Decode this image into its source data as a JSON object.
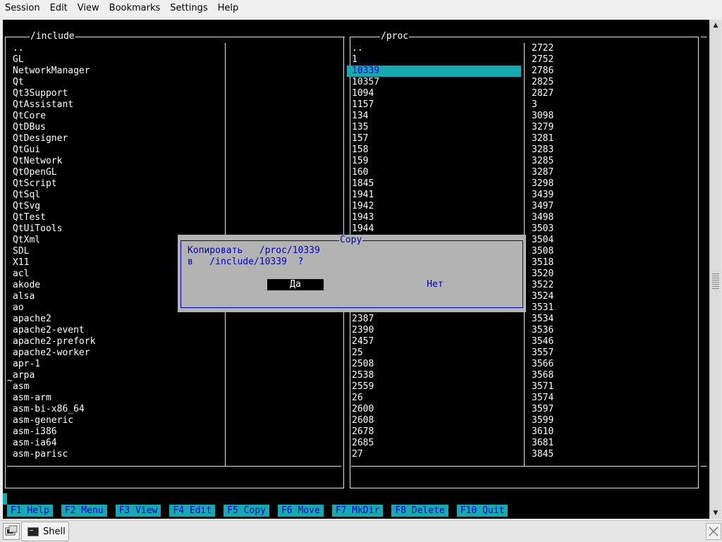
{
  "menubar": {
    "items": [
      "Session",
      "Edit",
      "View",
      "Bookmarks",
      "Settings",
      "Help"
    ]
  },
  "left_panel": {
    "title": "/include",
    "items": [
      "..",
      "GL",
      "NetworkManager",
      "Qt",
      "Qt3Support",
      "QtAssistant",
      "QtCore",
      "QtDBus",
      "QtDesigner",
      "QtGui",
      "QtNetwork",
      "QtOpenGL",
      "QtScript",
      "QtSql",
      "QtSvg",
      "QtTest",
      "QtUiTools",
      "QtXml",
      "SDL",
      "X11",
      "acl",
      "akode",
      "alsa",
      "ao",
      "apache2",
      "apache2-event",
      "apache2-prefork",
      "apache2-worker",
      "apr-1",
      "arpa",
      "asm",
      "asm-arm",
      "asm-bi-x86_64",
      "asm-generic",
      "asm-i386",
      "asm-ia64",
      "asm-parisc"
    ],
    "cursor_mark": "~"
  },
  "right_panel": {
    "title": "/proc",
    "selected": "10339",
    "col1_top": [
      "..",
      "1",
      "10339",
      "10357",
      "1094",
      "1157",
      "134",
      "135",
      "157",
      "158",
      "159",
      "160",
      "1845",
      "1941",
      "1942",
      "1943",
      "1944"
    ],
    "col1_bottom": [
      "2387",
      "2390",
      "2457",
      "25",
      "2508",
      "2538",
      "2559",
      "26",
      "2600",
      "2608",
      "2678",
      "2685",
      "27"
    ],
    "col2": [
      "2722",
      "2752",
      "2786",
      "2825",
      "2827",
      "3",
      "3098",
      "3279",
      "3281",
      "3283",
      "3285",
      "3287",
      "3298",
      "3439",
      "3497",
      "3498",
      "3503",
      "3504",
      "3508",
      "3518",
      "3520",
      "3522",
      "3524",
      "3531",
      "3534",
      "3536",
      "3546",
      "3557",
      "3566",
      "3568",
      "3571",
      "3574",
      "3597",
      "3599",
      "3610",
      "3681",
      "3845"
    ]
  },
  "dialog": {
    "title": "Copy",
    "line1": "Копировать   /proc/10339",
    "line2": "в   /include/10339  ?",
    "yes_label": "Да",
    "no_label": "Нет"
  },
  "function_keys": [
    "F1 Help",
    "F2 Menu",
    "F3 View",
    "F4 Edit",
    "F5 Copy",
    "F6 Move",
    "F7 MkDir",
    "F8 Delete",
    "F10 Quit"
  ],
  "taskbar": {
    "task_label": "Shell",
    "start_icon": "konsole-icon",
    "task_icon": "terminal-icon"
  },
  "colors": {
    "terminal_bg": "#000000",
    "selection_bg": "#17a9b1",
    "dialog_bg": "#b3b3b3",
    "dialog_fg": "#0000c0"
  }
}
